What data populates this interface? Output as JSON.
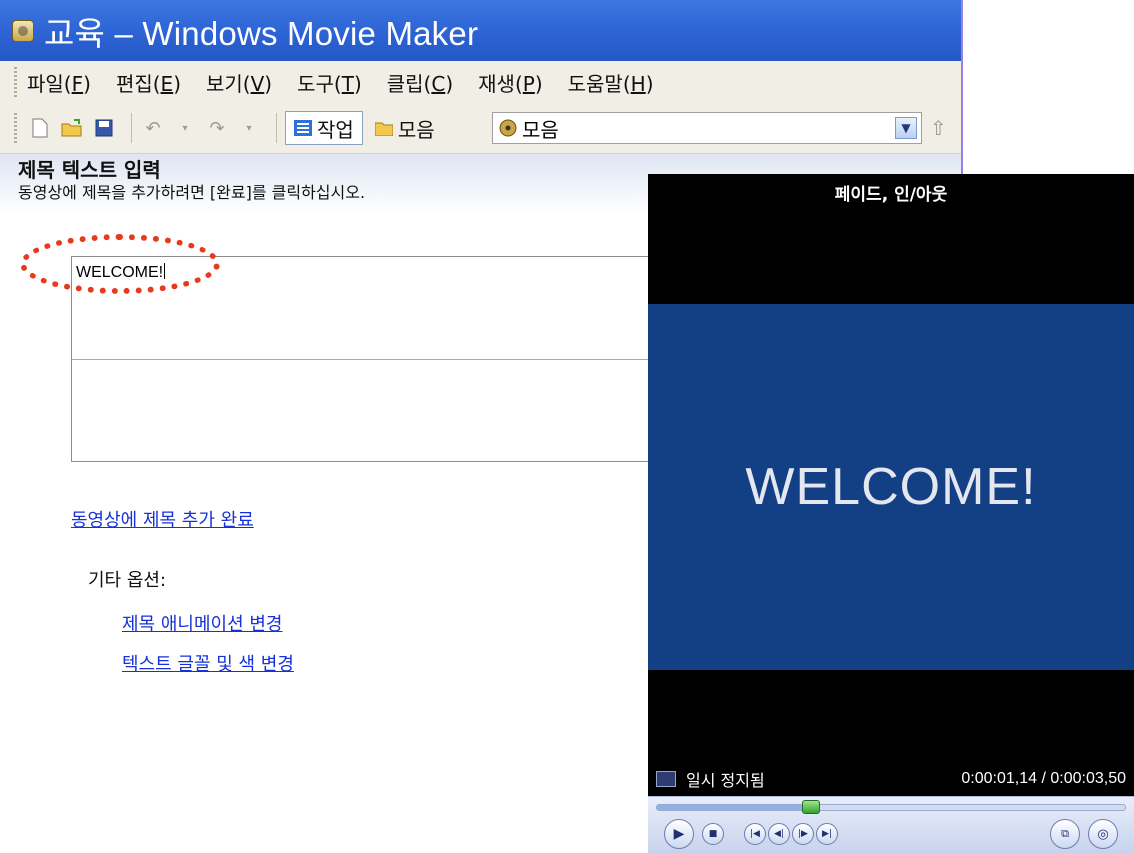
{
  "window": {
    "title": "교육 – Windows Movie Maker",
    "accent_color": "#2d63d4"
  },
  "menu": {
    "items": [
      {
        "label": "파일(",
        "accel": "F",
        "tail": ")"
      },
      {
        "label": "편집(",
        "accel": "E",
        "tail": ")"
      },
      {
        "label": "보기(",
        "accel": "V",
        "tail": ")"
      },
      {
        "label": "도구(",
        "accel": "T",
        "tail": ")"
      },
      {
        "label": "클립(",
        "accel": "C",
        "tail": ")"
      },
      {
        "label": "재생(",
        "accel": "P",
        "tail": ")"
      },
      {
        "label": "도움말(",
        "accel": "H",
        "tail": ")"
      }
    ]
  },
  "toolbar": {
    "icons": [
      "new-project-icon",
      "open-folder-icon",
      "save-icon",
      "undo-icon",
      "redo-icon"
    ],
    "tasks_label": "작업",
    "collections_label": "모음",
    "collection_select_value": "모음"
  },
  "task": {
    "heading": "제목 텍스트 입력",
    "instruction": "동영상에 제목을 추가하려면 [완료]를 클릭하십시오.",
    "title_text": "WELCOME!",
    "done_link": "동영상에 제목 추가 완료",
    "other_options_label": "기타 옵션:",
    "animation_link": "제목 애니메이션 변경",
    "font_color_link": "텍스트 글꼴 및 색 변경"
  },
  "preview": {
    "header": "페이드, 인/아웃",
    "video_text": "WELCOME!",
    "status": "일시 정지됨",
    "time": "0:00:01,14 / 0:00:03,50",
    "progress_fraction": 0.33,
    "video_bg": "#133f85"
  },
  "annotation": {
    "color": "#e83a1a"
  }
}
